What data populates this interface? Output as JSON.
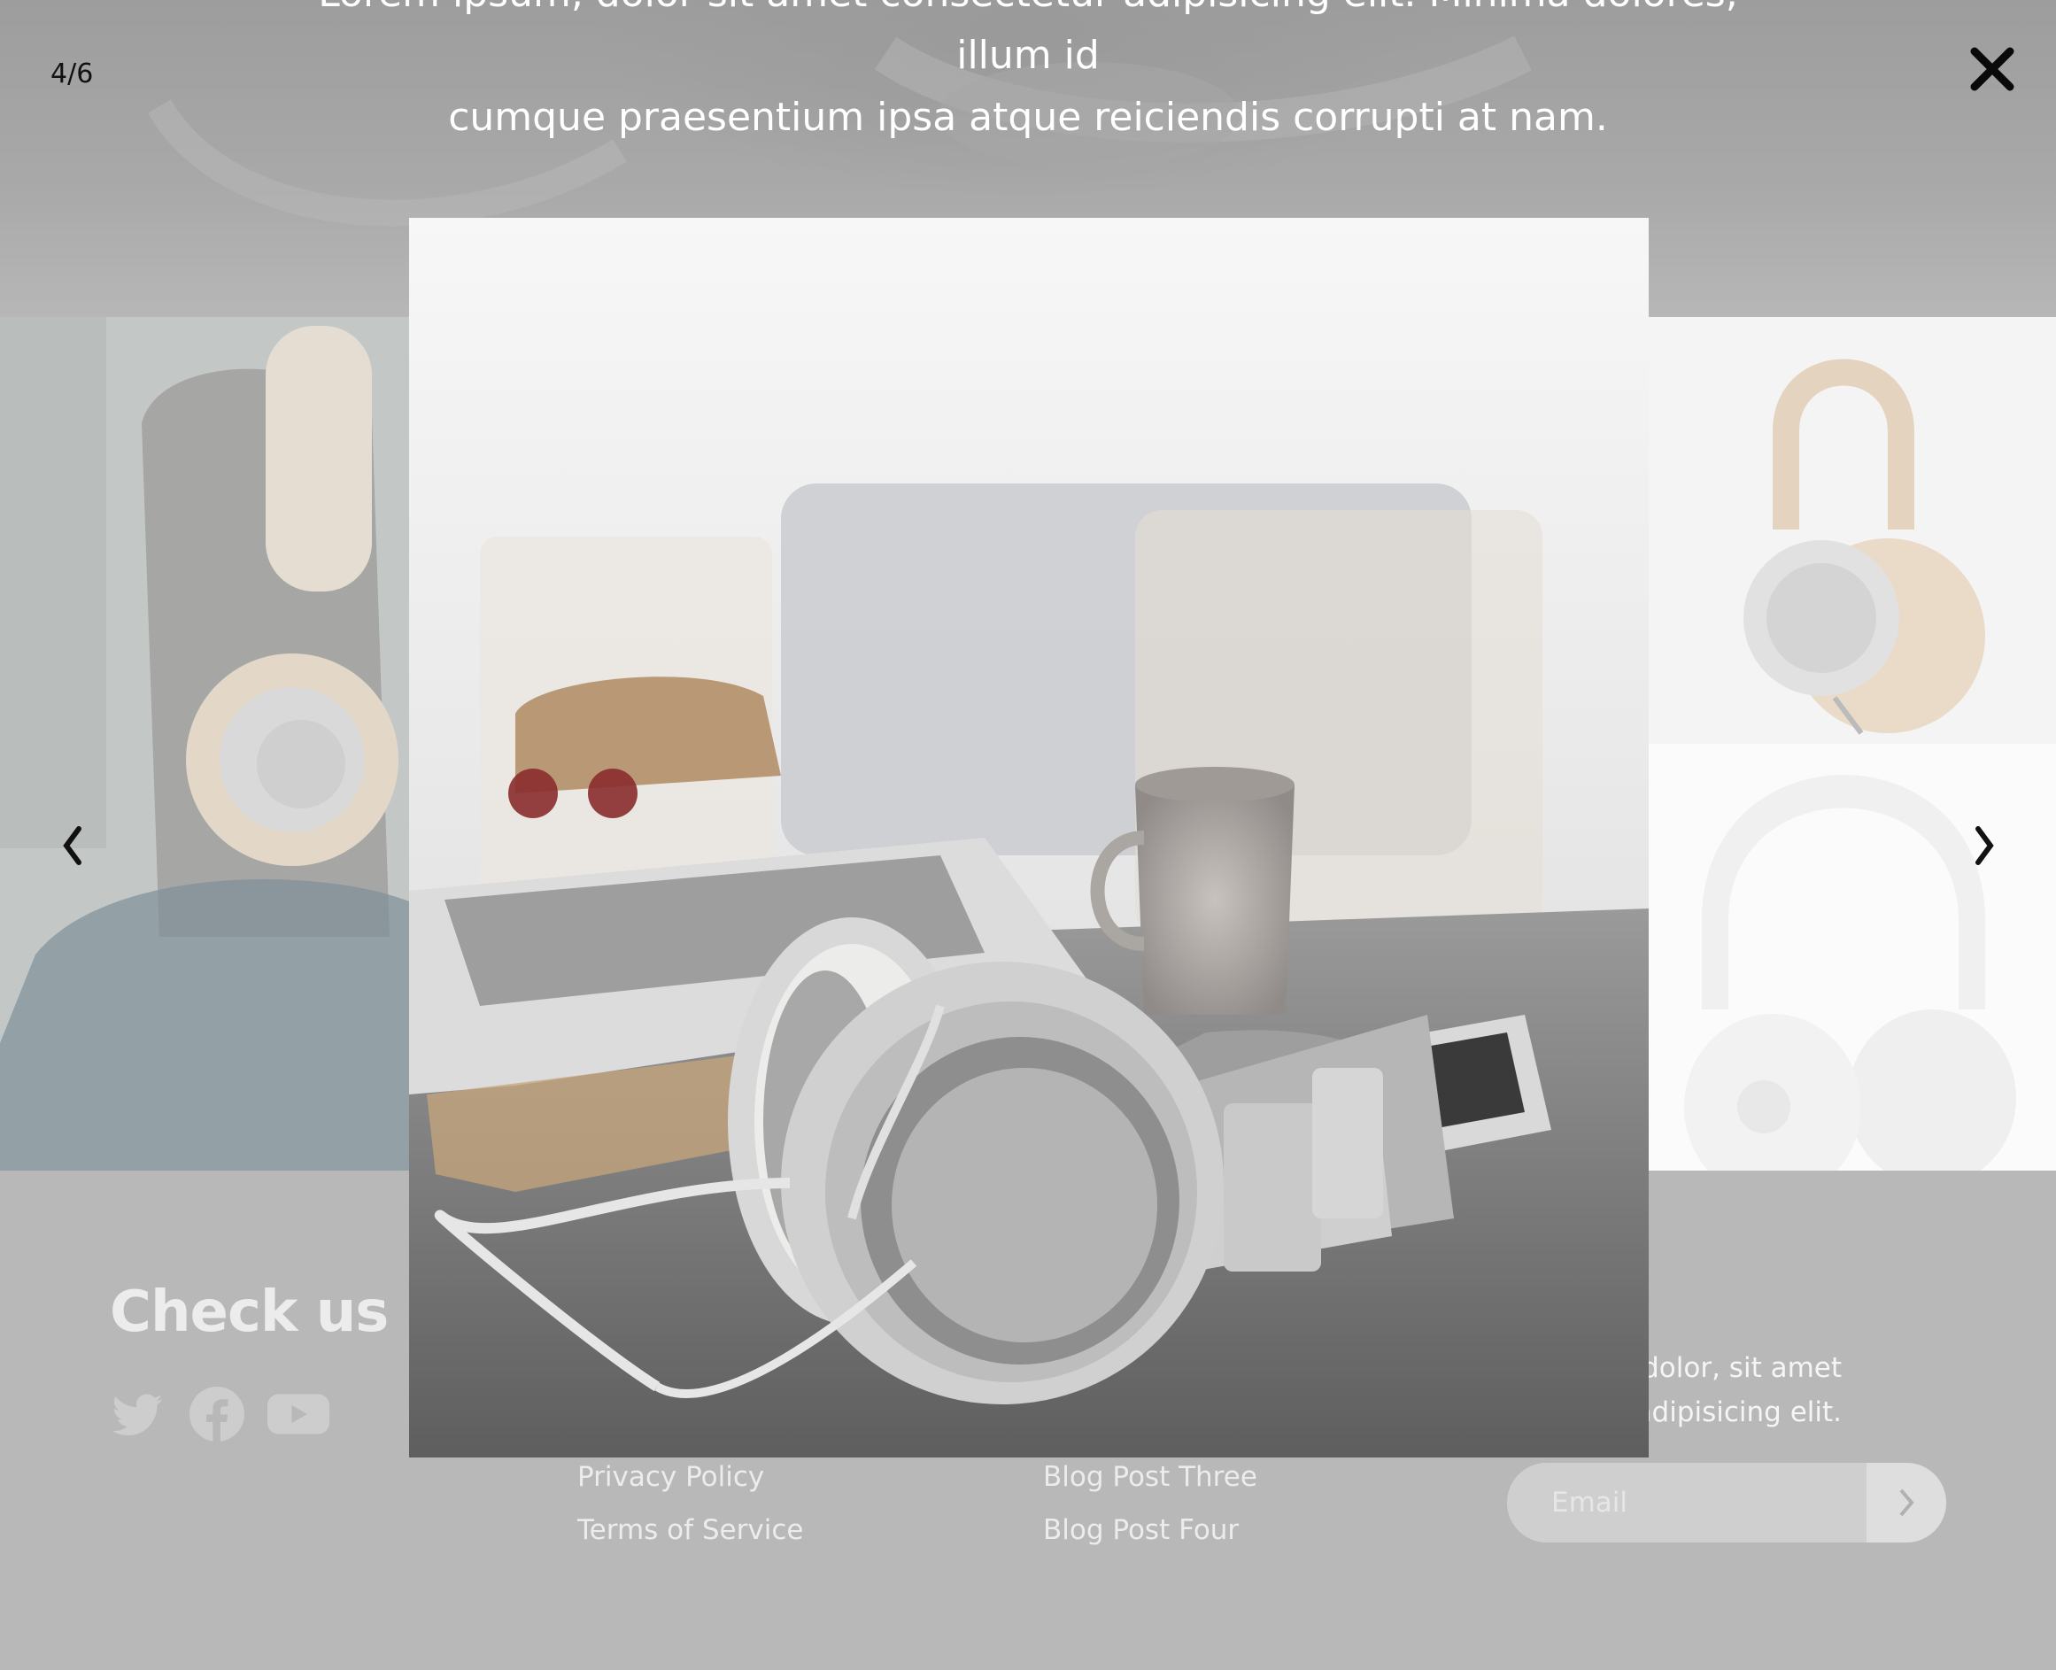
{
  "hero": {
    "line1": "Lorem ipsum, dolor sit amet consectetur adipisicing elit. Minima dolores, illum id",
    "line2": "cumque praesentium ipsa atque reiciendis corrupti at nam."
  },
  "footer": {
    "heading": "Check us out",
    "social": [
      "twitter-icon",
      "facebook-icon",
      "youtube-icon"
    ],
    "legal_links": [
      "Privacy Policy",
      "Terms of Service"
    ],
    "blog_links": [
      "Blog Post Three",
      "Blog Post Four"
    ],
    "newsletter": {
      "text_line1": "n dolor, sit amet",
      "text_line2": "adipisicing elit.",
      "email_placeholder": "Email",
      "submit_icon": "chevron-right-icon"
    }
  },
  "lightbox": {
    "counter": "4/6",
    "close_icon": "close-icon",
    "prev_icon": "chevron-left-icon",
    "next_icon": "chevron-right-icon"
  },
  "colors": {
    "overlay_tint": "#bdbdbd",
    "footer_text": "#ececec",
    "control": "#111111"
  }
}
